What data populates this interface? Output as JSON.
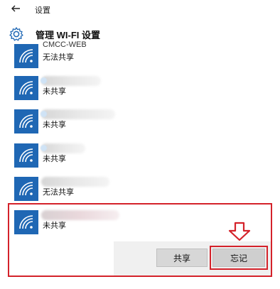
{
  "window": {
    "title": "设置"
  },
  "header": {
    "title": "管理 WI-FI 设置"
  },
  "networks": [
    {
      "name": "CMCC-WEB",
      "status": "无法共享"
    },
    {
      "name": "",
      "status": "未共享"
    },
    {
      "name": "",
      "status": "未共享"
    },
    {
      "name": "",
      "status": "未共享"
    },
    {
      "name": "",
      "status": "无法共享"
    },
    {
      "name": "",
      "status": "未共享"
    }
  ],
  "actions": {
    "share_label": "共享",
    "forget_label": "忘记"
  },
  "colors": {
    "wifi_tile": "#1f67b4",
    "highlight": "#d4222a"
  },
  "icons": [
    "back-arrow-icon",
    "gear-icon",
    "wifi-icon",
    "down-arrow-icon"
  ]
}
